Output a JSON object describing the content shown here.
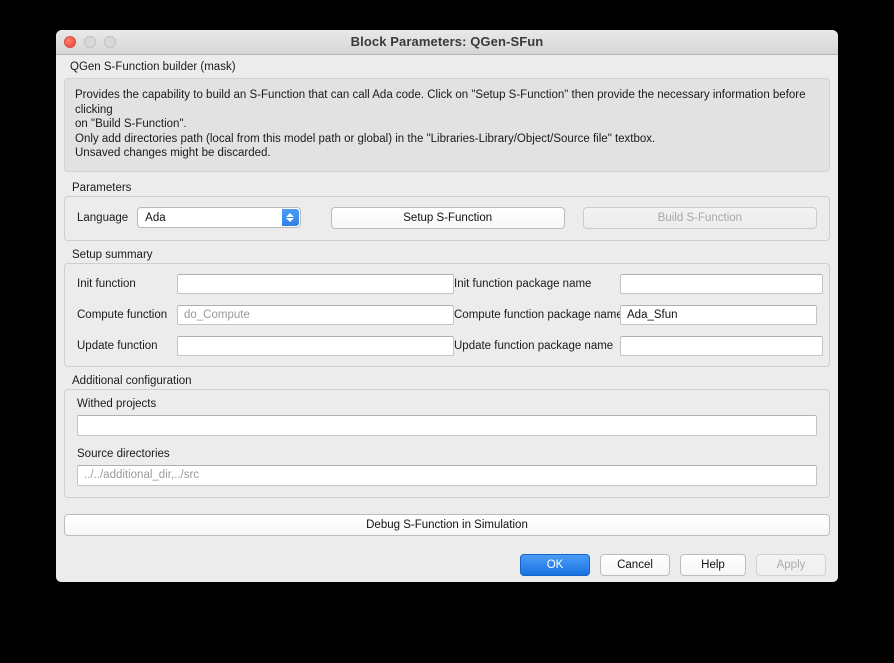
{
  "window": {
    "title": "Block Parameters: QGen-SFun",
    "traffic": {
      "close": "close-button",
      "minimize": "minimize-button",
      "maximize": "maximize-button"
    }
  },
  "mask": {
    "title": "QGen S-Function builder (mask)",
    "description_lines": [
      "Provides the capability to build an S-Function that can call Ada code. Click on \"Setup S-Function\" then provide the necessary information before clicking",
      "on \"Build S-Function\".",
      "Only add directories path (local from this model path or global) in the \"Libraries-Library/Object/Source file\" textbox.",
      "Unsaved changes might be discarded."
    ]
  },
  "parameters": {
    "group_label": "Parameters",
    "language_label": "Language",
    "language_value": "Ada",
    "language_options": [
      "Ada"
    ],
    "setup_button": "Setup S-Function",
    "build_button": "Build S-Function",
    "build_button_enabled": false
  },
  "setup_summary": {
    "group_label": "Setup summary",
    "rows": [
      {
        "left_label": "Init function",
        "left_value": "",
        "left_placeholder": "",
        "right_label": "Init function package name",
        "right_value": "",
        "right_placeholder": ""
      },
      {
        "left_label": "Compute function",
        "left_value": "",
        "left_placeholder": "do_Compute",
        "right_label": "Compute function package name",
        "right_value": "Ada_Sfun",
        "right_placeholder": ""
      },
      {
        "left_label": "Update function",
        "left_value": "",
        "left_placeholder": "",
        "right_label": "Update function package name",
        "right_value": "",
        "right_placeholder": ""
      }
    ]
  },
  "additional_configuration": {
    "group_label": "Additional configuration",
    "withed_projects_label": "Withed projects",
    "withed_projects_value": "",
    "withed_projects_placeholder": "",
    "source_directories_label": "Source directories",
    "source_directories_value": "",
    "source_directories_placeholder": "../../additional_dir,../src"
  },
  "debug": {
    "button_label": "Debug S-Function in Simulation"
  },
  "footer": {
    "ok": "OK",
    "cancel": "Cancel",
    "help": "Help",
    "apply": "Apply",
    "apply_enabled": false
  },
  "colors": {
    "accent": "#1b73e3",
    "window_bg": "#ececec",
    "description_bg": "#e2e2e2",
    "close_light": "#f2564a"
  }
}
